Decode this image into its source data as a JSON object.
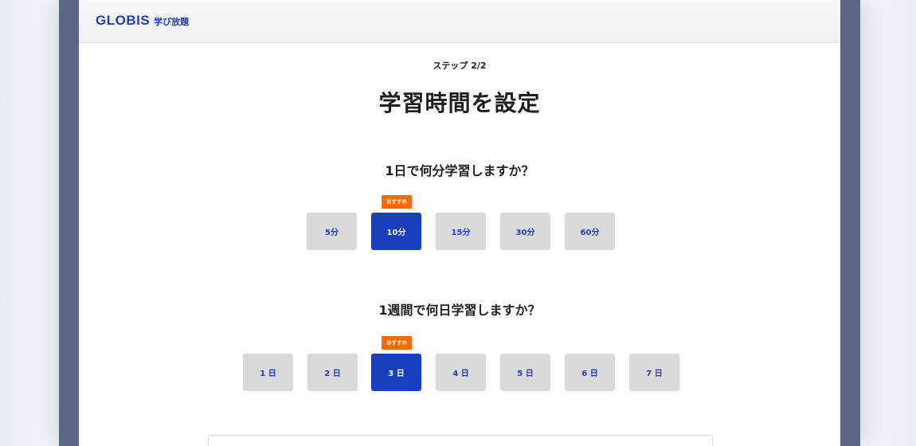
{
  "header": {
    "logo_word": "GLOBIS",
    "logo_sub": "学び放題"
  },
  "step_label": "ステップ 2/2",
  "title": "学習時間を設定",
  "daily": {
    "question": "1日で何分学習しますか？",
    "badge": "おすすめ",
    "options": [
      "5分",
      "10分",
      "15分",
      "30分",
      "60分"
    ],
    "selected": "10分"
  },
  "weekly": {
    "question": "1週間で何日学習しますか？",
    "badge": "おすすめ",
    "options": [
      "1 日",
      "2 日",
      "3 日",
      "4 日",
      "5 日",
      "6 日",
      "7 日"
    ],
    "selected": "3 日"
  },
  "colors": {
    "brand": "#1f3dbe",
    "selected": "#1a3fbe",
    "unselected": "#d9d9d9",
    "badge": "#ff6a00",
    "frame": "#5b6585"
  }
}
